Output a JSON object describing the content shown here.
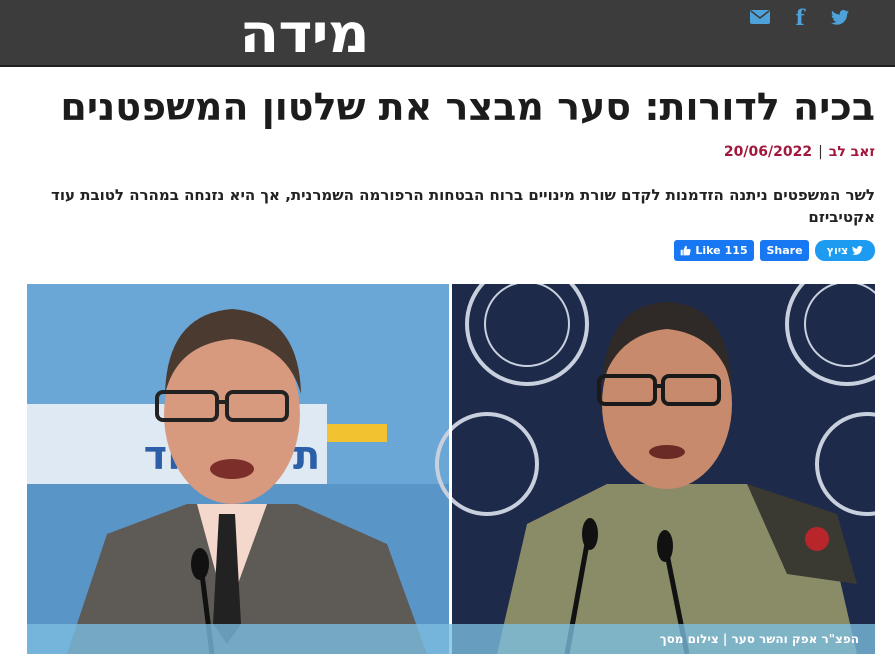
{
  "site": {
    "logo_text": "מידה",
    "social": [
      {
        "icon": "twitter-icon",
        "glyph": ""
      },
      {
        "icon": "facebook-icon",
        "glyph": "f"
      },
      {
        "icon": "email-icon",
        "glyph": ""
      }
    ]
  },
  "article": {
    "title": "בכיה לדורות: סער מבצר את שלטון המשפטנים",
    "author": "זאב לב",
    "date": "20/06/2022",
    "lead": "לשר המשפטים ניתנה הזדמנות לקדם שורת מינויים ברוח הבטחות הרפורמה השמרנית, אך היא נזנחה במהרה לטובת עוד אקטיביזם"
  },
  "share": {
    "tweet_label": "ציוץ",
    "share_label": "Share",
    "like_label": "Like",
    "like_count": "115"
  },
  "photo": {
    "caption": "הפצ\"ר אפק והשר סער | צילום מסך",
    "banner_text": "תקווה חד"
  },
  "colors": {
    "topbar": "#3c3c3c",
    "accent": "#a0193c",
    "social": "#4da3d9",
    "facebook": "#1877f2",
    "twitter": "#1d9bf0"
  }
}
